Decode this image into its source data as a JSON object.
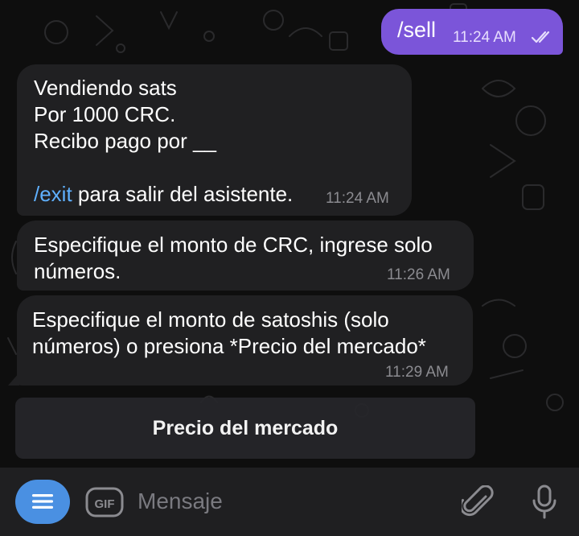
{
  "messages": {
    "outgoing": {
      "text": "/sell",
      "time": "11:24 AM"
    },
    "incoming": [
      {
        "lines": [
          "Vendiendo sats",
          "Por 1000 CRC.",
          "Recibo pago por __"
        ],
        "command": "/exit",
        "command_suffix": " para salir del asistente.",
        "time": "11:24 AM"
      },
      {
        "lines": [
          "Especifique el monto de CRC, ingrese solo",
          "números."
        ],
        "time": "11:26 AM"
      },
      {
        "lines": [
          "Especifique el monto de satoshis (solo",
          "números) o presiona *Precio del mercado*"
        ],
        "time": "11:29 AM"
      }
    ]
  },
  "keyboard": {
    "button_label": "Precio del mercado"
  },
  "input_bar": {
    "placeholder": "Mensaje",
    "gif_label": "GIF",
    "icons": [
      "menu-icon",
      "gif-icon",
      "paperclip-icon",
      "microphone-icon"
    ]
  },
  "colors": {
    "background": "#0e0e0e",
    "outgoing_bubble": "#7b55d9",
    "incoming_bubble": "#202022",
    "link": "#5fb0ff",
    "menu_button": "#4a90e2"
  }
}
